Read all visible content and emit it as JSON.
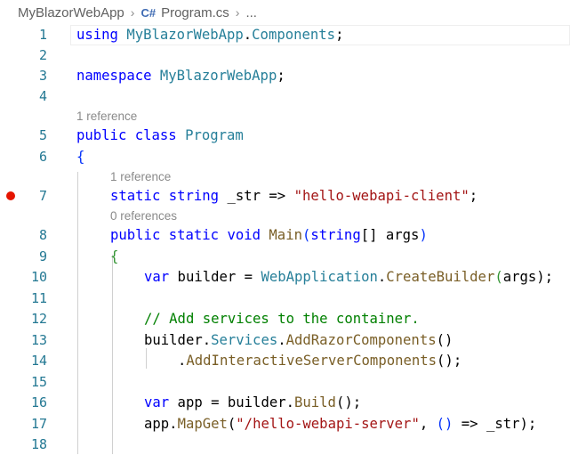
{
  "breadcrumb": {
    "project": "MyBlazorWebApp",
    "file_icon": "C#",
    "file": "Program.cs",
    "more": "..."
  },
  "codelens": {
    "class_refs": "1 reference",
    "str_refs": "1 reference",
    "main_refs": "0 references"
  },
  "lines": [
    {
      "n": "1"
    },
    {
      "n": "2"
    },
    {
      "n": "3"
    },
    {
      "n": "4"
    },
    {
      "n": "5"
    },
    {
      "n": "6"
    },
    {
      "n": "7"
    },
    {
      "n": "8"
    },
    {
      "n": "9"
    },
    {
      "n": "10"
    },
    {
      "n": "11"
    },
    {
      "n": "12"
    },
    {
      "n": "13"
    },
    {
      "n": "14"
    },
    {
      "n": "15"
    },
    {
      "n": "16"
    },
    {
      "n": "17"
    },
    {
      "n": "18"
    }
  ],
  "code": {
    "l1": [
      "using",
      " ",
      "MyBlazorWebApp",
      ".",
      "Components",
      ";"
    ],
    "l3": [
      "namespace",
      " ",
      "MyBlazorWebApp",
      ";"
    ],
    "l5": [
      "public",
      " ",
      "class",
      " ",
      "Program"
    ],
    "l6": [
      "{"
    ],
    "l7": [
      "static",
      " ",
      "string",
      " _str => ",
      "\"hello-webapi-client\"",
      ";"
    ],
    "l8": [
      "public",
      " ",
      "static",
      " ",
      "void",
      " ",
      "Main",
      "(",
      "string",
      "[] args",
      ")"
    ],
    "l9": [
      "{"
    ],
    "l10": [
      "var",
      " builder = ",
      "WebApplication",
      ".",
      "CreateBuilder",
      "(",
      "args",
      ");"
    ],
    "l12": [
      "// Add services to the container."
    ],
    "l13": [
      "builder",
      ".",
      "Services",
      ".",
      "AddRazorComponents",
      "()"
    ],
    "l14": [
      ".",
      "AddInteractiveServerComponents",
      "();"
    ],
    "l16": [
      "var",
      " app = ",
      "builder",
      ".",
      "Build",
      "();"
    ],
    "l17": [
      "app",
      ".",
      "MapGet",
      "(",
      "\"/hello-webapi-server\"",
      ", ",
      "()",
      " => _str);"
    ]
  },
  "colors": {
    "keyword": "#0000ff",
    "type": "#267f99",
    "method": "#795e26",
    "string": "#a31515",
    "comment": "#008000",
    "line_number": "#237893",
    "breakpoint": "#e51400"
  }
}
